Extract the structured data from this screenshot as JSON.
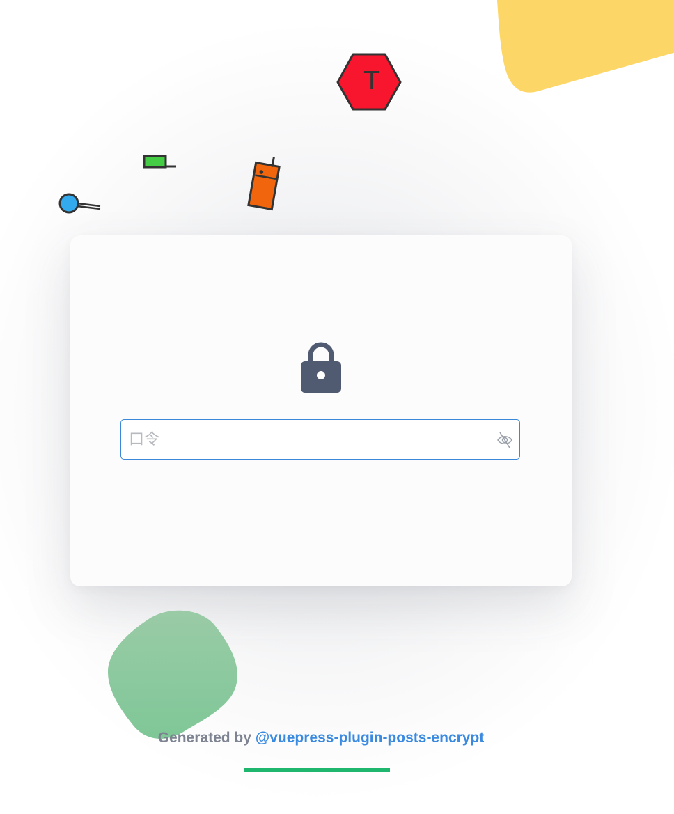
{
  "colors": {
    "accent_blue": "#3a8ae0",
    "input_border": "#3b88d8",
    "lock_color": "#505a70",
    "footer_text": "#7d8390",
    "footer_bar": "#1fb66e",
    "yellow_blob": "#fdd668",
    "green_blob": "#8dcb9b",
    "hexagon_red": "#f7162d",
    "phone_orange": "#f1660c",
    "battery_green": "#44cc44",
    "magnifier_blue": "#33aaee"
  },
  "decorations": {
    "hexagon_glyph": "T"
  },
  "icons": {
    "lock": "lock-icon",
    "eye_toggle": "eye-slash-icon",
    "hexagon": "hexagon-icon",
    "phone": "walkie-talkie-icon",
    "battery": "battery-icon",
    "magnifier": "magnifier-icon"
  },
  "login": {
    "password_placeholder": "口令",
    "password_value": ""
  },
  "footer": {
    "prefix": "Generated by ",
    "link_text": "@vuepress-plugin-posts-encrypt"
  }
}
